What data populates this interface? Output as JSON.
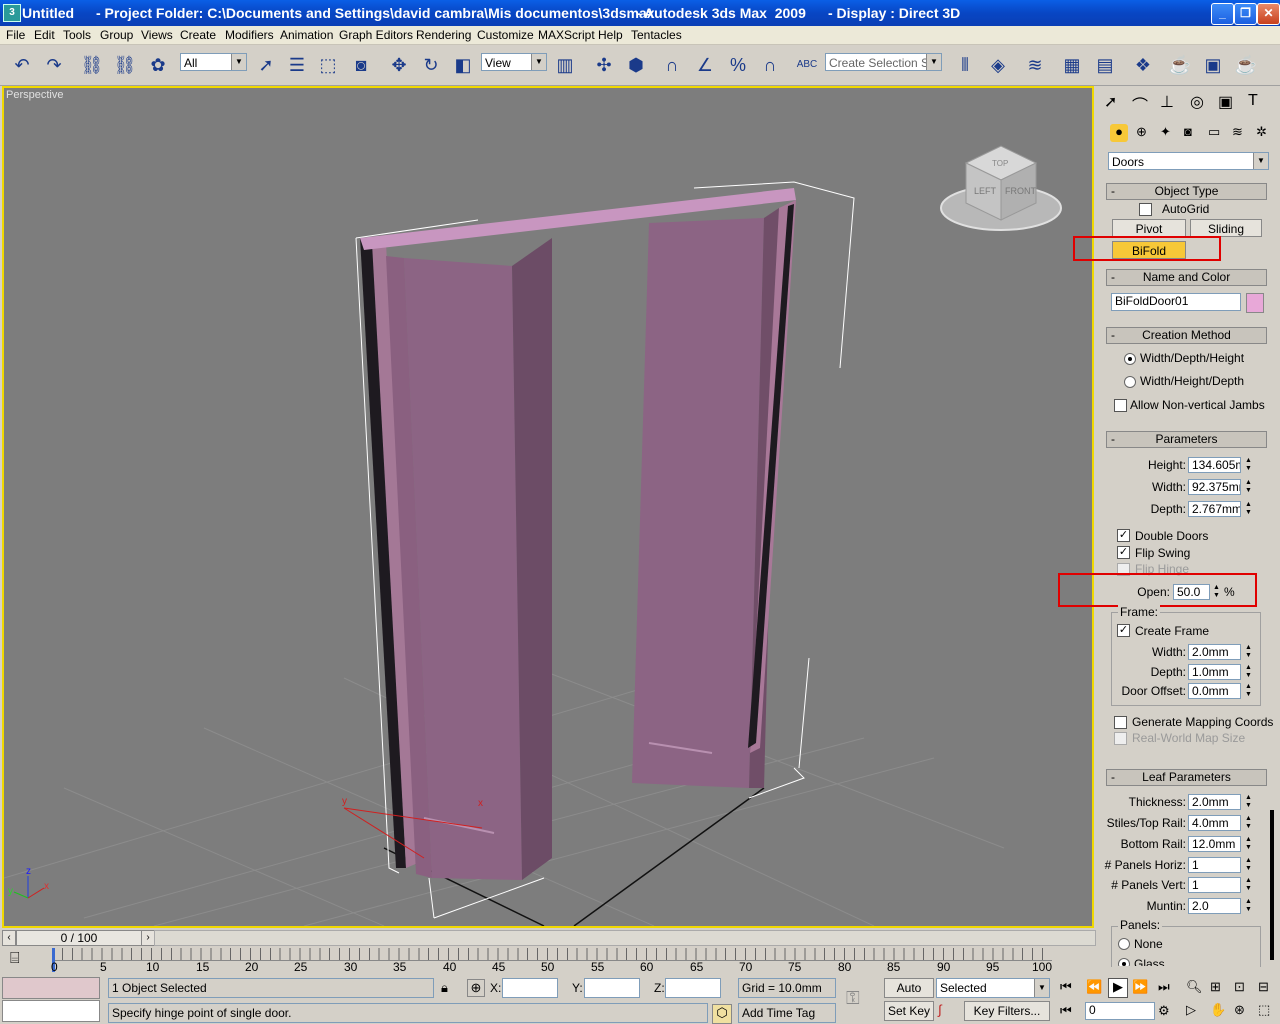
{
  "title": {
    "app": "Untitled",
    "project": "- Project Folder: C:\\Documents and Settings\\david cambra\\Mis documentos\\3dsmax",
    "product": "- Autodesk 3ds Max  2009",
    "display": "- Display : Direct 3D"
  },
  "menu": [
    "File",
    "Edit",
    "Tools",
    "Group",
    "Views",
    "Create",
    "Modifiers",
    "Animation",
    "Graph Editors",
    "Rendering",
    "Customize",
    "MAXScript",
    "Help",
    "Tentacles"
  ],
  "toolbar": {
    "filter": "All",
    "ref_coord": "View",
    "selection_set": "Create Selection Set",
    "abc_label": "ABC"
  },
  "viewport": {
    "label": "Perspective",
    "viewcube_left": "LEFT",
    "viewcube_front": "FRONT",
    "viewcube_top": "TOP",
    "axis_x": "x",
    "axis_y": "y",
    "axis_z": "z"
  },
  "panel": {
    "category": "Doors",
    "object_type": {
      "header": "Object Type",
      "autogrid": "AutoGrid",
      "pivot": "Pivot",
      "sliding": "Sliding",
      "bifold": "BiFold"
    },
    "name_color": {
      "header": "Name and Color",
      "name": "BiFoldDoor01",
      "color": "#e8a8d8"
    },
    "creation": {
      "header": "Creation Method",
      "opt1": "Width/Depth/Height",
      "opt2": "Width/Height/Depth",
      "nonvert": "Allow Non-vertical Jambs"
    },
    "params": {
      "header": "Parameters",
      "height_label": "Height:",
      "height": "134.605m",
      "width_label": "Width:",
      "width": "92.375mm",
      "depth_label": "Depth:",
      "depth": "2.767mm",
      "double_doors": "Double Doors",
      "flip_swing": "Flip Swing",
      "flip_hinge": "Flip Hinge",
      "open_label": "Open:",
      "open": "50.0",
      "open_unit": "%",
      "frame_label": "Frame:",
      "create_frame": "Create Frame",
      "fw_label": "Width:",
      "fw": "2.0mm",
      "fd_label": "Depth:",
      "fd": "1.0mm",
      "fo_label": "Door Offset:",
      "fo": "0.0mm",
      "gen_map": "Generate Mapping Coords",
      "real_world": "Real-World Map Size"
    },
    "leaf": {
      "header": "Leaf Parameters",
      "thick_label": "Thickness:",
      "thick": "2.0mm",
      "stiles_label": "Stiles/Top Rail:",
      "stiles": "4.0mm",
      "bottom_label": "Bottom Rail:",
      "bottom": "12.0mm",
      "ph_label": "# Panels Horiz:",
      "ph": "1",
      "pv_label": "# Panels Vert:",
      "pv": "1",
      "muntin_label": "Muntin:",
      "muntin": "2.0",
      "panels_label": "Panels:",
      "none": "None",
      "glass": "Glass"
    }
  },
  "timeline": {
    "frame": "0 / 100",
    "ticks": [
      "0",
      "5",
      "10",
      "15",
      "20",
      "25",
      "30",
      "35",
      "40",
      "45",
      "50",
      "55",
      "60",
      "65",
      "70",
      "75",
      "80",
      "85",
      "90",
      "95",
      "100"
    ]
  },
  "status": {
    "selected": "1 Object Selected",
    "prompt": "Specify hinge point of single door.",
    "x_label": "X:",
    "y_label": "Y:",
    "z_label": "Z:",
    "grid": "Grid = 10.0mm",
    "add_time_tag": "Add Time Tag",
    "auto_key": "Auto Key",
    "set_key": "Set Key",
    "key_mode": "Selected",
    "key_filters": "Key Filters...",
    "frame_field": "0"
  }
}
